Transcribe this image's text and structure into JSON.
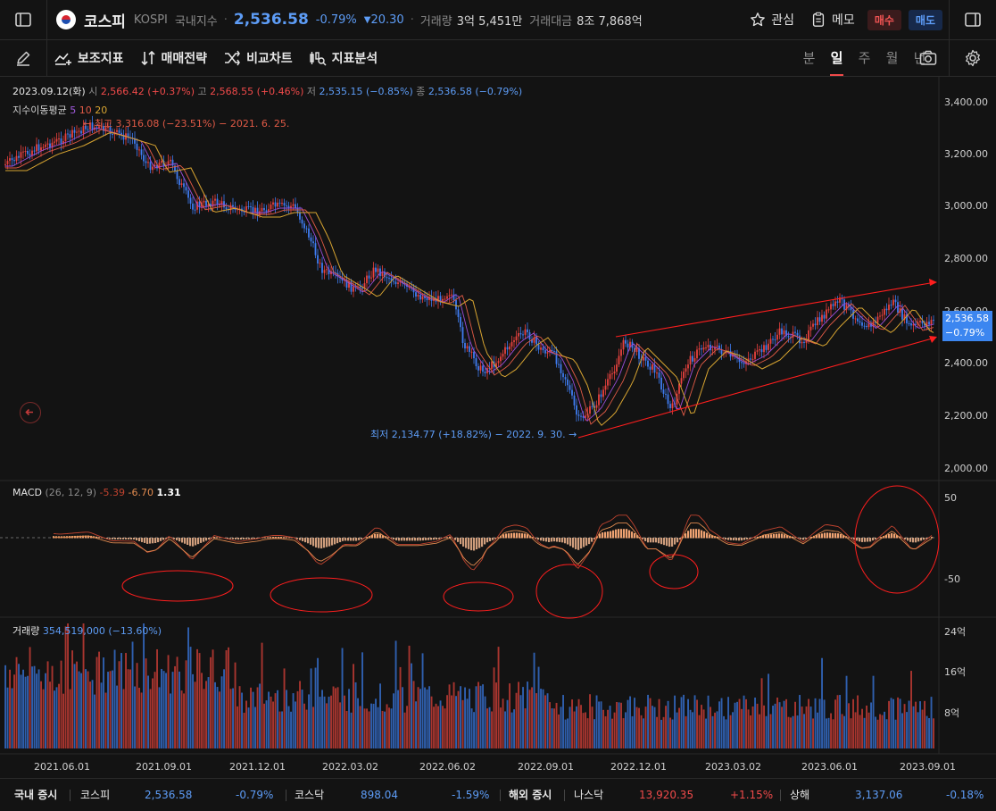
{
  "header": {
    "name": "코스피",
    "code": "KOSPI",
    "market": "국내지수",
    "price": "2,536.58",
    "change_pct": "-0.79%",
    "change_abs": "20.30",
    "volume_label": "거래량",
    "volume_value": "3억 5,451만",
    "amount_label": "거래대금",
    "amount_value": "8조 7,868억",
    "watch_label": "관심",
    "memo_label": "메모",
    "buy_label": "매수",
    "sell_label": "매도"
  },
  "toolbar": {
    "tools": [
      "보조지표",
      "매매전략",
      "비교차트",
      "지표분석"
    ],
    "periods": [
      "분",
      "일",
      "주",
      "월",
      "년"
    ],
    "active_period": "일"
  },
  "chart": {
    "ohlc": {
      "date": "2023.09.12(화)",
      "open_label": "시",
      "open": "2,566.42 (+0.37%)",
      "high_label": "고",
      "high": "2,568.55 (+0.46%)",
      "low_label": "저",
      "low": "2,535.15 (−0.85%)",
      "close_label": "종",
      "close": "2,536.58 (−0.79%)"
    },
    "ma": {
      "label": "지수이동평균",
      "p1": "5",
      "p2": "10",
      "p3": "20"
    },
    "high_note": "← 최고 3,316.08 (−23.51%) − 2021. 6. 25.",
    "low_note": "최저 2,134.77 (+18.82%) − 2022. 9. 30. →",
    "price_tag": {
      "price": "2,536.58",
      "pct": "−0.79%"
    },
    "price_axis": [
      "3,400.00",
      "3,200.00",
      "3,000.00",
      "2,800.00",
      "2,600.00",
      "2,400.00",
      "2,200.00",
      "2,000.00"
    ],
    "dates": [
      "2021.06.01",
      "2021.09.01",
      "2021.12.01",
      "2022.03.02",
      "2022.06.02",
      "2022.09.01",
      "2022.12.01",
      "2023.03.02",
      "2023.06.01",
      "2023.09.01"
    ],
    "macd": {
      "label": "MACD",
      "params": "(26, 12, 9)",
      "v1": "-5.39",
      "v2": "-6.70",
      "v3": "1.31",
      "axis": [
        "50",
        "-50"
      ]
    },
    "volume": {
      "label": "거래량",
      "value": "354,519,000 (−13.60%)",
      "axis": [
        "24억",
        "16억",
        "8억"
      ]
    },
    "colors": {
      "up": "#e8423f",
      "down": "#3f7cf0",
      "ma5": "#9a4dd6",
      "ma10": "#e05a46",
      "ma20": "#d7a431",
      "macd_pos": "#f0a372",
      "annotation": "#ff1e1e"
    }
  },
  "footer": {
    "domestic_label": "국내 증시",
    "kospi_name": "코스피",
    "kospi_value": "2,536.58",
    "kospi_pct": "-0.79%",
    "kosdaq_name": "코스닥",
    "kosdaq_value": "898.04",
    "kosdaq_pct": "-1.59%",
    "overseas_label": "해외 증시",
    "nasdaq_name": "나스닥",
    "nasdaq_value": "13,920.35",
    "nasdaq_pct": "+1.15%",
    "shanghai_name": "상해",
    "shanghai_value": "3,137.06",
    "shanghai_pct": "-0.18%"
  }
}
